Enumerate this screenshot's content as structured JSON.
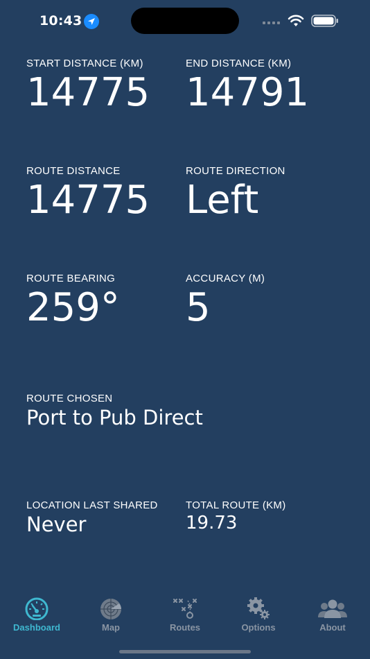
{
  "status_bar": {
    "time": "10:43",
    "location_icon": "location-arrow-icon",
    "signal_icon": "cellular-signal-icon",
    "wifi_icon": "wifi-icon",
    "battery_icon": "battery-icon"
  },
  "dashboard": {
    "start_distance": {
      "label": "START DISTANCE (KM)",
      "value": "14775"
    },
    "end_distance": {
      "label": "END DISTANCE (KM)",
      "value": "14791"
    },
    "route_distance": {
      "label": "ROUTE DISTANCE",
      "value": "14775"
    },
    "route_direction": {
      "label": "ROUTE DIRECTION",
      "value": "Left"
    },
    "route_bearing": {
      "label": "ROUTE BEARING",
      "value": "259°"
    },
    "accuracy": {
      "label": "ACCURACY (M)",
      "value": "5"
    },
    "route_chosen": {
      "label": "ROUTE CHOSEN",
      "value": "Port to Pub Direct"
    },
    "location_last_shared": {
      "label": "LOCATION LAST SHARED",
      "value": "Never"
    },
    "total_route": {
      "label": "TOTAL ROUTE (KM)",
      "value": "19.73"
    }
  },
  "tab_bar": {
    "tabs": [
      {
        "label": "Dashboard",
        "icon": "speedometer-icon",
        "active": true
      },
      {
        "label": "Map",
        "icon": "radar-icon",
        "active": false
      },
      {
        "label": "Routes",
        "icon": "route-plan-icon",
        "active": false
      },
      {
        "label": "Options",
        "icon": "gears-icon",
        "active": false
      },
      {
        "label": "About",
        "icon": "people-icon",
        "active": false
      }
    ]
  },
  "colors": {
    "background": "#233f60",
    "text": "#ffffff",
    "tab_active": "#3fb8d0",
    "tab_inactive": "#8a95a3"
  }
}
